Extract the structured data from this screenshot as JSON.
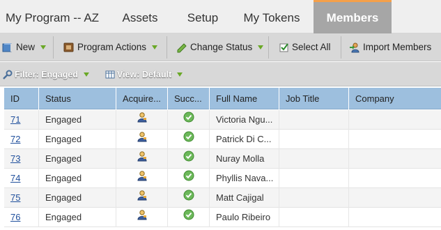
{
  "tabs": [
    {
      "label": "My Program -- AZ",
      "active": false
    },
    {
      "label": "Assets",
      "active": false
    },
    {
      "label": "Setup",
      "active": false
    },
    {
      "label": "My Tokens",
      "active": false
    },
    {
      "label": "Members",
      "active": true
    }
  ],
  "toolbar": {
    "new_label": "New",
    "program_actions_label": "Program Actions",
    "change_status_label": "Change Status",
    "select_all_label": "Select All",
    "import_members_label": "Import Members"
  },
  "filterbar": {
    "filter_label": "Filter: Engaged",
    "view_label": "View: Default"
  },
  "grid": {
    "columns": [
      "ID",
      "Status",
      "Acquire...",
      "Succ...",
      "Full Name",
      "Job Title",
      "Company"
    ],
    "rows": [
      {
        "id": "71",
        "status": "Engaged",
        "acquired_icon": "person-acquired-icon",
        "success_icon": "check-success-icon",
        "full_name": "Victoria Ngu...",
        "job_title": "",
        "company": ""
      },
      {
        "id": "72",
        "status": "Engaged",
        "acquired_icon": "person-acquired-icon",
        "success_icon": "check-success-icon",
        "full_name": "Patrick Di C...",
        "job_title": "",
        "company": ""
      },
      {
        "id": "73",
        "status": "Engaged",
        "acquired_icon": "person-acquired-icon",
        "success_icon": "check-success-icon",
        "full_name": "Nuray Molla",
        "job_title": "",
        "company": ""
      },
      {
        "id": "74",
        "status": "Engaged",
        "acquired_icon": "person-acquired-icon",
        "success_icon": "check-success-icon",
        "full_name": "Phyllis Nava...",
        "job_title": "",
        "company": ""
      },
      {
        "id": "75",
        "status": "Engaged",
        "acquired_icon": "person-acquired-icon",
        "success_icon": "check-success-icon",
        "full_name": "Matt Cajigal",
        "job_title": "",
        "company": ""
      },
      {
        "id": "76",
        "status": "Engaged",
        "acquired_icon": "person-acquired-icon",
        "success_icon": "check-success-icon",
        "full_name": "Paulo Ribeiro",
        "job_title": "",
        "company": ""
      }
    ]
  },
  "colors": {
    "active_tab_bg": "#a6a6a6",
    "active_tab_accent": "#f5a04a",
    "grid_header_bg": "#9dbfde",
    "link": "#1f4f9c",
    "dropdown_arrow": "#6aa826"
  }
}
